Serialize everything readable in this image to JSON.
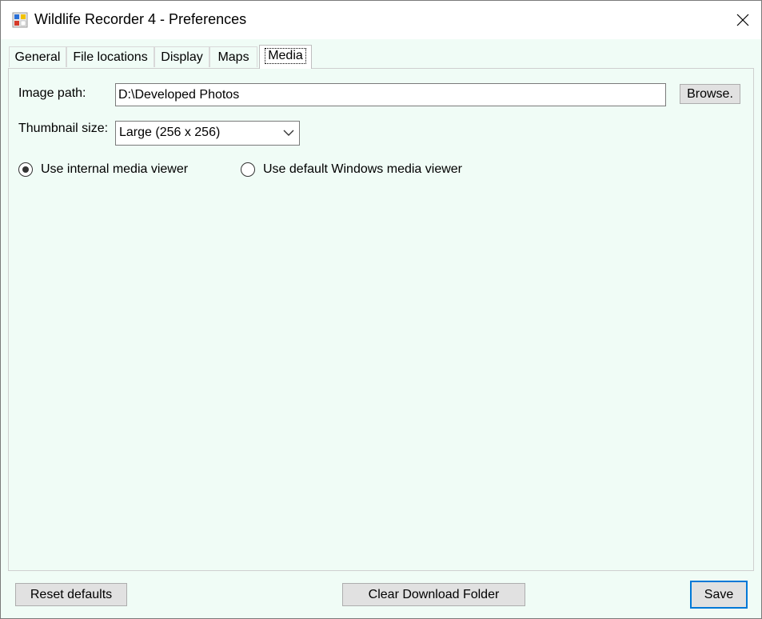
{
  "window": {
    "title": "Wildlife Recorder 4 - Preferences",
    "icon": "app-icon"
  },
  "tabs": [
    {
      "label": "General",
      "active": false
    },
    {
      "label": "File locations",
      "active": false
    },
    {
      "label": "Display",
      "active": false
    },
    {
      "label": "Maps",
      "active": false
    },
    {
      "label": "Media",
      "active": true
    }
  ],
  "media": {
    "image_path_label": "Image path:",
    "image_path_value": "D:\\Developed Photos",
    "browse_label": "Browse.",
    "thumbnail_label": "Thumbnail size:",
    "thumbnail_value": "Large (256 x 256)",
    "radio_internal_label": "Use internal media viewer",
    "radio_internal_checked": true,
    "radio_default_label": "Use default Windows media viewer",
    "radio_default_checked": false
  },
  "footer": {
    "reset_label": "Reset defaults",
    "clear_label": "Clear Download Folder",
    "save_label": "Save"
  },
  "colors": {
    "panel_bg": "#f0fcf6",
    "button_bg": "#e1e1e1",
    "default_button_border": "#0078d7"
  }
}
